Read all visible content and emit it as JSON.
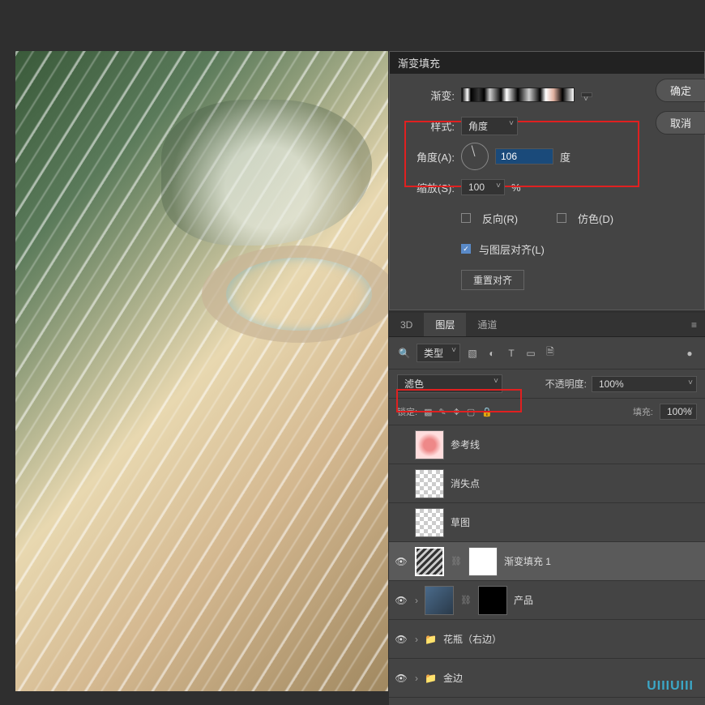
{
  "dialog": {
    "title": "渐变填充",
    "gradient_label": "渐变:",
    "style_label": "样式:",
    "style_value": "角度",
    "angle_label": "角度(A):",
    "angle_value": "106",
    "angle_unit": "度",
    "scale_label": "缩放(S):",
    "scale_value": "100",
    "scale_unit": "%",
    "reverse_label": "反向(R)",
    "dither_label": "仿色(D)",
    "align_label": "与图层对齐(L)",
    "reset_btn": "重置对齐",
    "ok_btn": "确定",
    "cancel_btn": "取消"
  },
  "layers": {
    "tabs": [
      "3D",
      "图层",
      "通道"
    ],
    "filter_label": "类型",
    "blend_mode": "滤色",
    "opacity_label": "不透明度:",
    "opacity_value": "100%",
    "lock_label": "锁定:",
    "fill_label": "填充:",
    "fill_value": "100%",
    "items": [
      {
        "name": "参考线",
        "thumb": "dot",
        "vis": false
      },
      {
        "name": "消失点",
        "thumb": "checker",
        "vis": false
      },
      {
        "name": "草图",
        "thumb": "checker",
        "vis": false
      },
      {
        "name": "渐变填充 1",
        "thumb": "striped",
        "vis": true,
        "mask": true,
        "selected": true
      },
      {
        "name": "产品",
        "thumb": "blue",
        "vis": true,
        "mask": true,
        "maskblack": true
      },
      {
        "name": "花瓶（右边）",
        "thumb": "folder",
        "vis": true
      },
      {
        "name": "金边",
        "thumb": "folder",
        "vis": true
      }
    ]
  },
  "watermark": "UIIIUIII"
}
